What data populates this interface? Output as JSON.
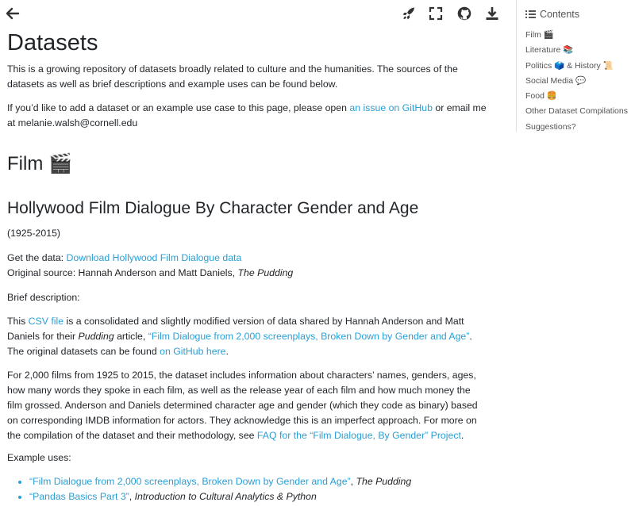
{
  "toc": {
    "heading": "Contents",
    "items": [
      "Film 🎬",
      "Literature 📚",
      "Politics 🗳️ & History 📜",
      "Social Media 💬",
      "Food 🍔",
      "Other Dataset Compilations",
      "Suggestions?"
    ]
  },
  "page": {
    "title": "Datasets",
    "intro": "This is a growing repository of datasets broadly related to culture and the humanities. The sources of the datasets as well as brief descriptions and example uses can be found below.",
    "contrib_pre": "If you’d like to add a dataset or an example use case to this page, please open ",
    "contrib_link": "an issue on GitHub",
    "contrib_post": " or email me at melanie.walsh@cornell.edu",
    "section_film": "Film 🎬",
    "dataset_title": "Hollywood Film Dialogue By Character Gender and Age",
    "years": "(1925-2015)",
    "get_data_label": "Get the data: ",
    "get_data_link": "Download Hollywood Film Dialogue data",
    "source_label": "Original source: Hannah Anderson and Matt Daniels, ",
    "source_pub": "The Pudding",
    "brief_label": "Brief description:",
    "desc1_a": "This ",
    "desc1_link1": "CSV file",
    "desc1_b": " is a consolidated and slightly modified version of data shared by Hannah Anderson and Matt Daniels for their ",
    "desc1_em": "Pudding",
    "desc1_c": " article, ",
    "desc1_link2": "“Film Dialogue from 2,000 screenplays, Broken Down by Gender and Age”",
    "desc1_d": ". The original datasets can be found ",
    "desc1_link3": "on GitHub here",
    "desc1_e": ".",
    "desc2_a": "For 2,000 films from 1925 to 2015, the dataset includes information about characters’ names, genders, ages, how many words they spoke in each film, as well as the release year of each film and how much money the film grossed. Anderson and Daniels determined character age and gender (which they code as binary) based on corresponding IMDB information for actors. They acknowledge this is an imperfect approach. For more on the compilation of the dataset and their methodology, see ",
    "desc2_link": "FAQ for the “Film Dialogue, By Gender” Project",
    "desc2_b": ".",
    "uses_label": "Example uses:",
    "uses": [
      {
        "link": "“Film Dialogue from 2,000 screenplays, Broken Down by Gender and Age”",
        "sep": ", ",
        "pub": "The Pudding"
      },
      {
        "link": "“Pandas Basics Part 3”",
        "sep": ", ",
        "pub": "Introduction to Cultural Analytics & Python"
      }
    ]
  },
  "icons": {
    "back": "arrow-left-icon",
    "launch": "rocket-icon",
    "fullscreen": "fullscreen-icon",
    "repo": "github-icon",
    "download": "download-icon",
    "toc": "list-icon"
  },
  "colors": {
    "link": "#2a9fd6",
    "text": "#212529",
    "toc_text": "#555555"
  }
}
